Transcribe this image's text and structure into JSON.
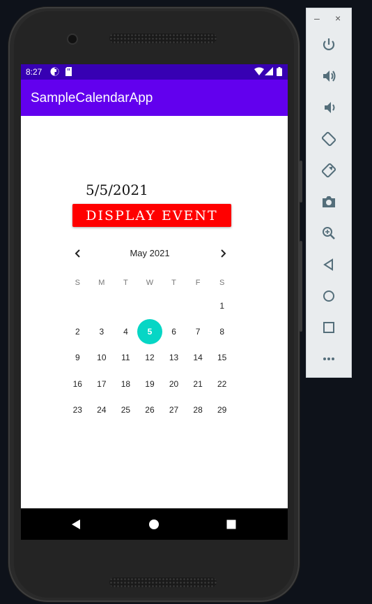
{
  "status_bar": {
    "time": "8:27"
  },
  "app_bar": {
    "title": "SampleCalendarApp"
  },
  "content": {
    "selected_date_text": "5/5/2021",
    "display_button_label": "DISPLAY EVENT"
  },
  "calendar": {
    "month_label": "May 2021",
    "weekdays": [
      "S",
      "M",
      "T",
      "W",
      "T",
      "F",
      "S"
    ],
    "weeks": [
      [
        "",
        "",
        "",
        "",
        "",
        "",
        "1"
      ],
      [
        "2",
        "3",
        "4",
        "5",
        "6",
        "7",
        "8"
      ],
      [
        "9",
        "10",
        "11",
        "12",
        "13",
        "14",
        "15"
      ],
      [
        "16",
        "17",
        "18",
        "19",
        "20",
        "21",
        "22"
      ],
      [
        "23",
        "24",
        "25",
        "26",
        "27",
        "28",
        "29"
      ]
    ],
    "selected_day": "5",
    "selected_color": "#06d6c5"
  },
  "colors": {
    "status_bar": "#3700b3",
    "app_bar": "#6200ee",
    "button": "#ff0000"
  },
  "emulator_controls": {
    "window_minimize": "–",
    "window_close": "×",
    "buttons": [
      "power-icon",
      "volume-up-icon",
      "volume-down-icon",
      "rotate-left-icon",
      "rotate-right-icon",
      "camera-icon",
      "zoom-icon",
      "back-icon",
      "home-icon",
      "overview-icon",
      "more-icon"
    ]
  }
}
